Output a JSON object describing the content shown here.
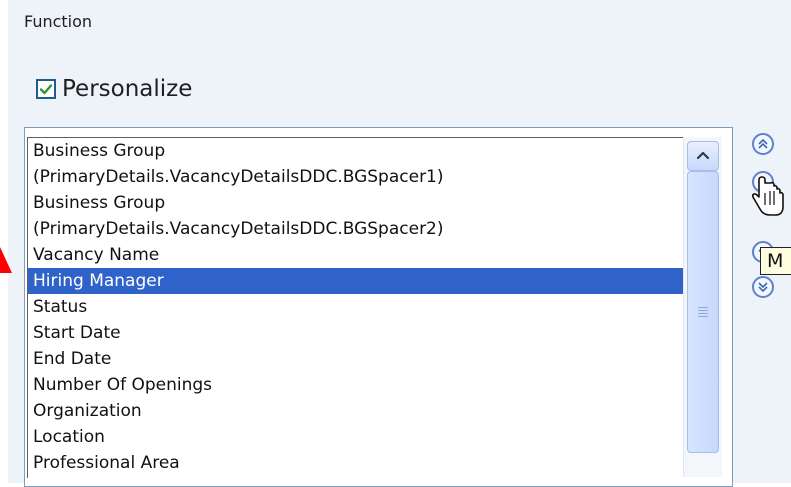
{
  "section": {
    "title": "Function"
  },
  "personalize": {
    "label": "Personalize",
    "checked": true
  },
  "list": {
    "items": [
      "Business Group",
      "(PrimaryDetails.VacancyDetailsDDC.BGSpacer1)",
      "Business Group",
      "(PrimaryDetails.VacancyDetailsDDC.BGSpacer2)",
      "Vacancy Name",
      "Hiring Manager",
      "Status",
      "Start Date",
      "End Date",
      "Number Of Openings",
      "Organization",
      "Location",
      "Professional Area"
    ],
    "selected_index": 5
  },
  "side_controls": {
    "move_top": "double-up-arrow-icon",
    "move_up": "up-arrow-icon",
    "move_down": "down-arrow-icon",
    "move_bottom": "double-down-arrow-icon"
  },
  "tooltip": {
    "text": "M"
  },
  "colors": {
    "accent": "#2f63c9",
    "panel_bg": "#eef2f9",
    "border": "#7f9db9",
    "indicator": "#ff0000"
  }
}
